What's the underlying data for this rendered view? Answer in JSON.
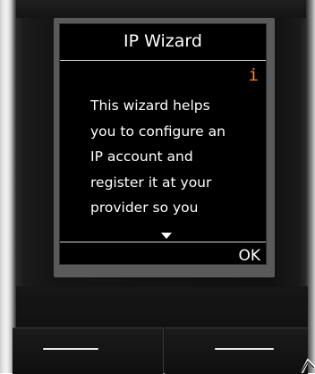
{
  "display": {
    "title": "IP Wizard",
    "info_icon": "i",
    "body_lines": [
      "This wizard helps",
      "you to configure an",
      "IP account and",
      "register it at your",
      "provider so you"
    ],
    "scroll_indicator": "down-arrow-icon",
    "right_softkey_label": "OK"
  },
  "colors": {
    "screen_background": "#000000",
    "text": "#ffffff",
    "info_icon": "#ff8a1e",
    "handset_body": "#141414"
  }
}
